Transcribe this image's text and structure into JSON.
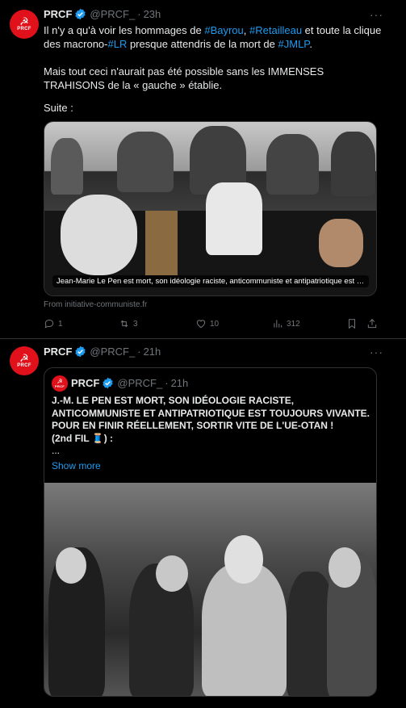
{
  "tweet1": {
    "avatar_text": "PRCF",
    "name": "PRCF",
    "handle": "@PRCF_",
    "time": "23h",
    "more": "···",
    "line1_pre": "Il n'y a qu'à voir les hommages de ",
    "ht_bayrou": "#Bayrou",
    "comma": ", ",
    "ht_retailleau": "#Retailleau",
    "line1_post": " et toute la clique des macrono-",
    "ht_lr": "#LR",
    "line1_mid": " presque attendris de la mort de ",
    "ht_jmlp": "#JMLP",
    "period": ".",
    "para2": "Mais tout ceci n'aurait pas été possible sans les IMMENSES TRAHISONS de la « gauche » établie.",
    "para3": "Suite :",
    "card_title": "Jean-Marie Le Pen est mort, son idéologie raciste, anticommuniste et antipatriotique est toujours vivante",
    "card_source": "From initiative-communiste.fr",
    "actions": {
      "replies": "1",
      "reposts": "3",
      "likes": "10",
      "views": "312"
    }
  },
  "tweet2": {
    "avatar_text": "PRCF",
    "name": "PRCF",
    "handle": "@PRCF_",
    "time": "21h",
    "more": "···",
    "quote": {
      "avatar_text": "PRCF",
      "name": "PRCF",
      "handle": "@PRCF_",
      "time": "21h",
      "text": "J.-M. LE PEN EST MORT, SON IDÉOLOGIE RACISTE, ANTICOMMUNISTE ET ANTIPATRIOTIQUE EST TOUJOURS VIVANTE. POUR EN FINIR RÉELLEMENT, SORTIR VITE DE L'UE-OTAN !",
      "thread_label": "(2nd FIL 🧵) :",
      "ellipsis": "...",
      "show_more": "Show more"
    }
  },
  "colors": {
    "accent": "#1d9bf0",
    "brand": "#e0111b",
    "muted": "#71767b",
    "text": "#e7e9ea",
    "border": "#2f3336"
  }
}
